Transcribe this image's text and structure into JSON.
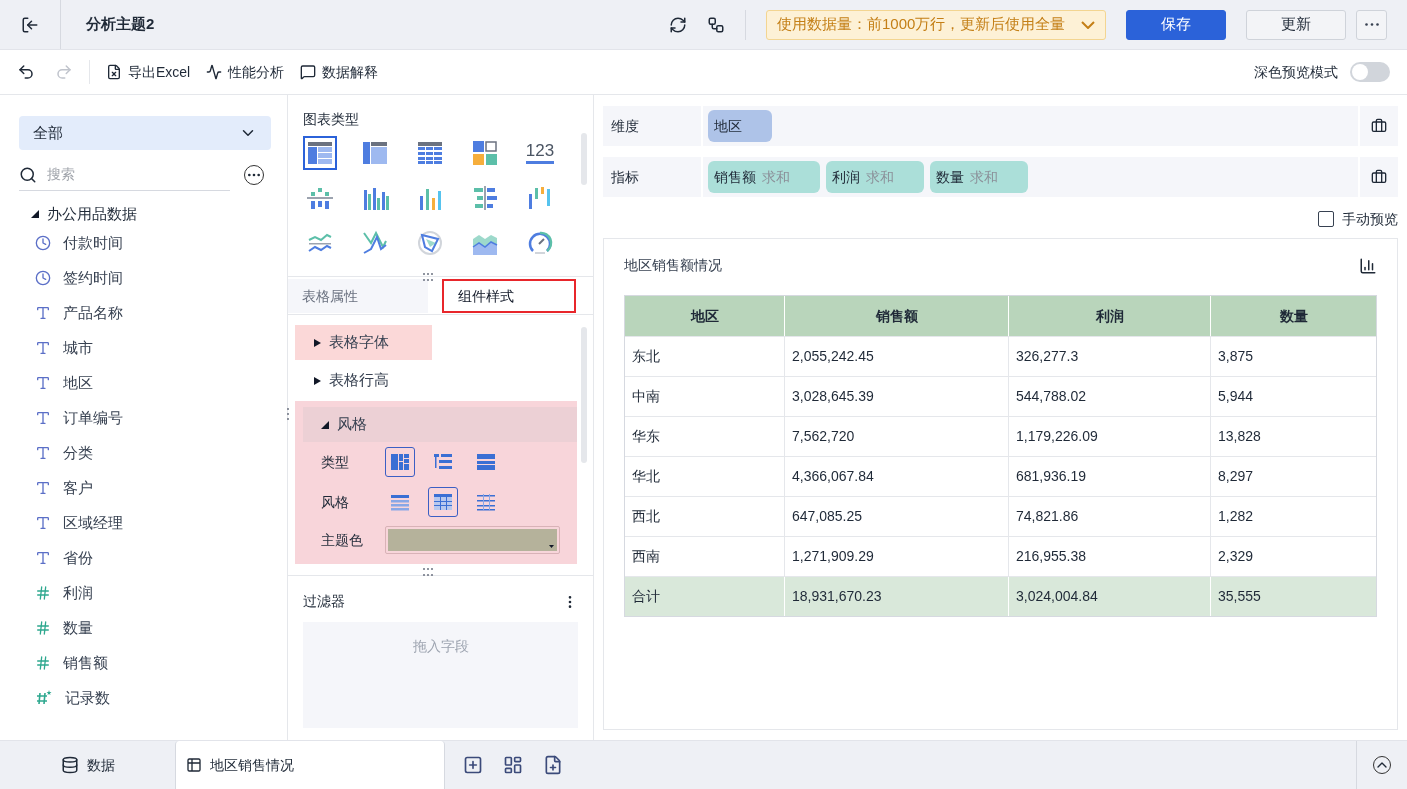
{
  "header": {
    "title": "分析主题2",
    "notice": "使用数据量：前1000万行，更新后使用全量",
    "buttons": [
      {
        "label": "保存",
        "kind": "primary"
      },
      {
        "label": "更新",
        "kind": "default"
      }
    ]
  },
  "toolbar": {
    "items": [
      {
        "label": "导出Excel",
        "kind": "excel"
      },
      {
        "label": "性能分析",
        "kind": "perf"
      },
      {
        "label": "数据解释",
        "kind": "explain"
      }
    ],
    "dark_preview": {
      "label": "深色预览模式",
      "on": false
    }
  },
  "field_panel": {
    "scope": "全部",
    "search_placeholder": "搜索",
    "group": {
      "name": "办公用品数据",
      "expanded": true,
      "children": [
        {
          "name": "付款时间",
          "kind": "time"
        },
        {
          "name": "签约时间",
          "kind": "time"
        },
        {
          "name": "产品名称",
          "kind": "text"
        },
        {
          "name": "城市",
          "kind": "text"
        },
        {
          "name": "地区",
          "kind": "text"
        },
        {
          "name": "订单编号",
          "kind": "text"
        },
        {
          "name": "分类",
          "kind": "text"
        },
        {
          "name": "客户",
          "kind": "text"
        },
        {
          "name": "区域经理",
          "kind": "text"
        },
        {
          "name": "省份",
          "kind": "text"
        },
        {
          "name": "利润",
          "kind": "number"
        },
        {
          "name": "数量",
          "kind": "number"
        },
        {
          "name": "销售额",
          "kind": "number"
        },
        {
          "name": "记录数",
          "kind": "count"
        }
      ]
    }
  },
  "chart_types": {
    "title": "图表类型",
    "items": [
      {
        "kind": "table",
        "selected": true
      },
      {
        "kind": "cross-table",
        "selected": false
      },
      {
        "kind": "detail-table",
        "selected": false
      },
      {
        "kind": "dashboard",
        "selected": false
      },
      {
        "kind": "kpi",
        "label": "123",
        "selected": false
      },
      {
        "kind": "stacked",
        "selected": false
      },
      {
        "kind": "grouped",
        "selected": false
      },
      {
        "kind": "column",
        "selected": false
      },
      {
        "kind": "horizontal",
        "selected": false
      },
      {
        "kind": "waterfall",
        "selected": false
      },
      {
        "kind": "line",
        "selected": false
      },
      {
        "kind": "polyline",
        "selected": false
      },
      {
        "kind": "radar",
        "selected": false
      },
      {
        "kind": "area",
        "selected": false
      },
      {
        "kind": "gauge",
        "selected": false
      }
    ]
  },
  "property_tabs": [
    {
      "label": "表格属性",
      "selected": false,
      "highlighted": false
    },
    {
      "label": "组件样式",
      "selected": true,
      "highlighted": true
    }
  ],
  "style_sections": [
    {
      "label": "表格字体",
      "expanded": false,
      "highlighted": true
    },
    {
      "label": "表格行高",
      "expanded": false,
      "highlighted": false
    },
    {
      "label": "风格",
      "expanded": true,
      "highlighted": true
    }
  ],
  "style_options": {
    "type": {
      "label": "类型",
      "options": [
        {
          "kind": "grouped",
          "selected": true
        },
        {
          "kind": "tree",
          "selected": false
        },
        {
          "kind": "collapse",
          "selected": false
        }
      ]
    },
    "style": {
      "label": "风格",
      "options": [
        {
          "kind": "stripe",
          "selected": false
        },
        {
          "kind": "grid",
          "selected": true
        },
        {
          "kind": "lines",
          "selected": false
        }
      ]
    },
    "theme": {
      "label": "主题色",
      "color": "#b5b29b"
    }
  },
  "filter": {
    "title": "过滤器",
    "placeholder": "拖入字段"
  },
  "dimensions": {
    "label": "维度",
    "chips": [
      {
        "name": "地区"
      }
    ]
  },
  "measures": {
    "label": "指标",
    "chips": [
      {
        "name": "销售额",
        "agg": "求和"
      },
      {
        "name": "利润",
        "agg": "求和"
      },
      {
        "name": "数量",
        "agg": "求和"
      }
    ]
  },
  "manual_preview": {
    "label": "手动预览",
    "checked": false
  },
  "table": {
    "title": "地区销售额情况",
    "columns": [
      "地区",
      "销售额",
      "利润",
      "数量"
    ],
    "rows": [
      [
        "东北",
        "2,055,242.45",
        "326,277.3",
        "3,875"
      ],
      [
        "中南",
        "3,028,645.39",
        "544,788.02",
        "5,944"
      ],
      [
        "华东",
        "7,562,720",
        "1,179,226.09",
        "13,828"
      ],
      [
        "华北",
        "4,366,067.84",
        "681,936.19",
        "8,297"
      ],
      [
        "西北",
        "647,085.25",
        "74,821.86",
        "1,282"
      ],
      [
        "西南",
        "1,271,909.29",
        "216,955.38",
        "2,329"
      ]
    ],
    "total": [
      "合计",
      "18,931,670.23",
      "3,024,004.84",
      "35,555"
    ]
  },
  "bottom_tabs": [
    {
      "label": "数据",
      "kind": "data",
      "selected": false
    },
    {
      "label": "地区销售情况",
      "kind": "sheet",
      "selected": true
    }
  ]
}
